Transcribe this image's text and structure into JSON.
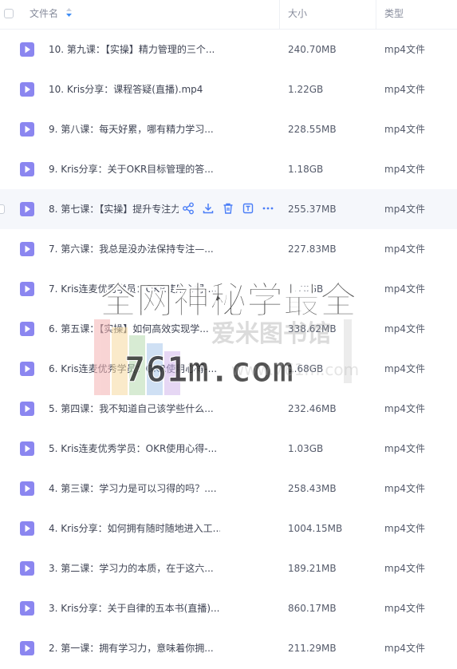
{
  "header": {
    "name_label": "文件名",
    "size_label": "大小",
    "type_label": "类型"
  },
  "files": [
    {
      "name": "10. 第九课：【实操】精力管理的三个...",
      "size": "240.70MB",
      "type": "mp4文件"
    },
    {
      "name": "10. Kris分享：课程答疑(直播).mp4",
      "size": "1.22GB",
      "type": "mp4文件"
    },
    {
      "name": "9. 第八课：每天好累，哪有精力学习...",
      "size": "228.55MB",
      "type": "mp4文件"
    },
    {
      "name": "9. Kris分享：关于OKR目标管理的答...",
      "size": "1.18GB",
      "type": "mp4文件"
    },
    {
      "name": "8. 第七课：【实操】提升专注力",
      "size": "255.37MB",
      "type": "mp4文件"
    },
    {
      "name": "7. 第六课：我总是没办法保持专注—...",
      "size": "227.83MB",
      "type": "mp4文件"
    },
    {
      "name": "7. Kris连麦优秀学员：OKR使用心得-...",
      "size": "1.70GB",
      "type": "mp4文件"
    },
    {
      "name": "6. 第五课：【实操】如何高效实现学...",
      "size": "338.62MB",
      "type": "mp4文件"
    },
    {
      "name": "6. Kris连麦优秀学员：OKR使用心得-...",
      "size": "1.68GB",
      "type": "mp4文件"
    },
    {
      "name": "5. 第四课：我不知道自己该学些什么...",
      "size": "232.46MB",
      "type": "mp4文件"
    },
    {
      "name": "5. Kris连麦优秀学员：OKR使用心得-...",
      "size": "1.03GB",
      "type": "mp4文件"
    },
    {
      "name": "4. 第三课：学习力是可以习得的吗？....",
      "size": "258.43MB",
      "type": "mp4文件"
    },
    {
      "name": "4. Kris分享：如何拥有随时随地进入工...",
      "size": "1004.15MB",
      "type": "mp4文件"
    },
    {
      "name": "3. 第二课：学习力的本质，在于这六...",
      "size": "189.21MB",
      "type": "mp4文件"
    },
    {
      "name": "3. Kris分享：关于自律的五本书(直播)....",
      "size": "860.17MB",
      "type": "mp4文件"
    },
    {
      "name": "2. 第一课：拥有学习力，意味着你拥...",
      "size": "211.29MB",
      "type": "mp4文件"
    }
  ],
  "watermark": {
    "line1": "全网神秘学最全",
    "line2": "761m.com",
    "line3": "爱米图书馆",
    "line4": "www.761m.com"
  },
  "colors": {
    "file_icon": "#8b86f0",
    "action_icon": "#4a7ef7"
  }
}
